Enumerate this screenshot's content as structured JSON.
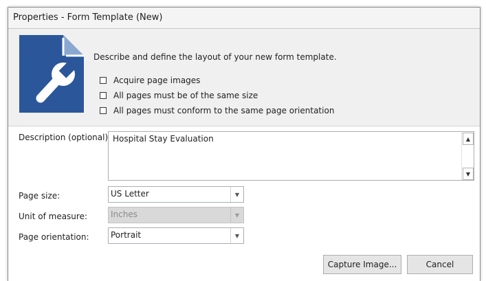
{
  "window": {
    "title": "Properties - Form Template (New)"
  },
  "header": {
    "description": "Describe and define the layout of your new form template.",
    "options": [
      {
        "label": "Acquire page images",
        "checked": false
      },
      {
        "label": "All pages must be of the same size",
        "checked": false
      },
      {
        "label": "All pages must conform to the same page orientation",
        "checked": false
      }
    ],
    "icon": "form-template-wrench-icon",
    "icon_color": "#2b579a"
  },
  "form": {
    "description_label": "Description (optional):",
    "description_value": "Hospital Stay Evaluation",
    "page_size_label": "Page size:",
    "page_size_value": "US Letter",
    "unit_label": "Unit of measure:",
    "unit_value": "Inches",
    "orientation_label": "Page orientation:",
    "orientation_value": "Portrait"
  },
  "buttons": {
    "capture": "Capture Image...",
    "cancel": "Cancel"
  }
}
